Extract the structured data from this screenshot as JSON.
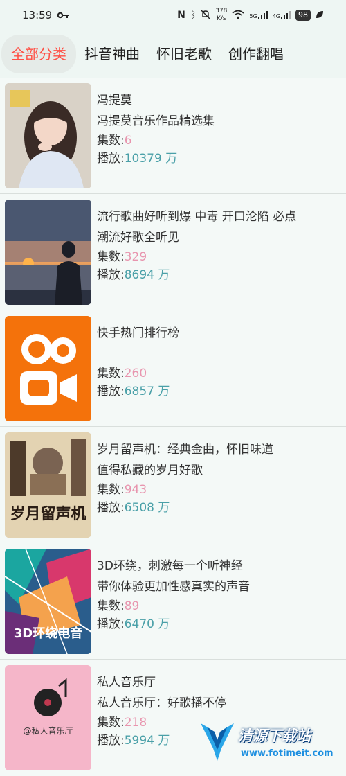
{
  "status": {
    "time": "13:59",
    "speed_value": "378",
    "speed_unit": "K/s",
    "net1": "5G",
    "net2": "4G",
    "battery": "98"
  },
  "tabs": [
    {
      "label": "全部分类",
      "active": true
    },
    {
      "label": "抖音神曲",
      "active": false
    },
    {
      "label": "怀旧老歌",
      "active": false
    },
    {
      "label": "创作翻唱",
      "active": false
    }
  ],
  "items": [
    {
      "title": "冯提莫",
      "desc": "冯提莫音乐作品精选集",
      "count_label": "集数:",
      "count": "6",
      "plays_label": "播放:",
      "plays": "10379 万"
    },
    {
      "title": "流行歌曲好听到爆 中毒 开口沦陷 必点",
      "desc": "潮流好歌全听见",
      "count_label": "集数:",
      "count": "329",
      "plays_label": "播放:",
      "plays": "8694 万"
    },
    {
      "title": "快手热门排行榜",
      "desc": "",
      "count_label": "集数:",
      "count": "260",
      "plays_label": "播放:",
      "plays": "6857 万"
    },
    {
      "title": "岁月留声机：经典金曲，怀旧味道",
      "desc": "值得私藏的岁月好歌",
      "count_label": "集数:",
      "count": "943",
      "plays_label": "播放:",
      "plays": "6508 万",
      "cover_text": "岁月留声机"
    },
    {
      "title": "3D环绕，刺激每一个听神经",
      "desc": "带你体验更加性感真实的声音",
      "count_label": "集数:",
      "count": "89",
      "plays_label": "播放:",
      "plays": "6470 万",
      "cover_text": "3D环绕电音"
    },
    {
      "title": "私人音乐厅",
      "desc": "私人音乐厅：好歌播不停",
      "count_label": "集数:",
      "count": "218",
      "plays_label": "播放:",
      "plays": "5994 万",
      "cover_text": "@私人音乐厅"
    }
  ],
  "watermark": {
    "name": "清源下载站",
    "url": "www.fotimeit.com"
  }
}
